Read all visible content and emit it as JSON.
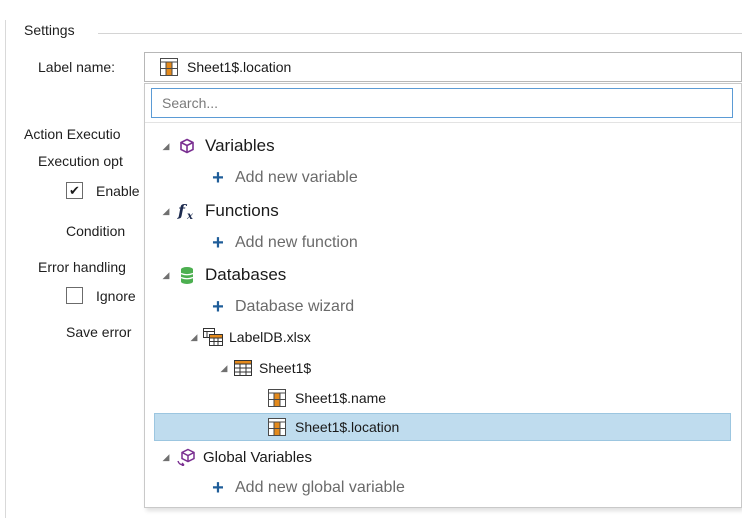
{
  "settings": {
    "title": "Settings",
    "label_name_label": "Label name:",
    "label_name_value": "Sheet1$.location",
    "action_execution": "Action Executio",
    "execution_options": "Execution opt",
    "enable_label": "Enable",
    "enable_checked": true,
    "condition_label": "Condition",
    "error_handling": "Error handling",
    "ignore_label": "Ignore",
    "ignore_checked": false,
    "save_error_label": "Save error"
  },
  "dropdown": {
    "search_placeholder": "Search...",
    "variables": {
      "label": "Variables",
      "add": "Add new variable"
    },
    "functions": {
      "label": "Functions",
      "add": "Add new function"
    },
    "databases": {
      "label": "Databases",
      "add": "Database wizard",
      "file": "LabelDB.xlsx",
      "sheet": "Sheet1$",
      "fields": [
        "Sheet1$.name",
        "Sheet1$.location"
      ]
    },
    "global_variables": {
      "label": "Global Variables",
      "add": "Add new global variable"
    },
    "selected": "Sheet1$.location"
  },
  "colors": {
    "selected_bg": "#bfdcee",
    "plus_blue": "#1f5d99",
    "variables_purple": "#7a2f91",
    "functions_navy": "#1d2b4f",
    "databases_green": "#4caf50",
    "field_orange": "#e48a1c",
    "search_border": "#5b9bd5"
  }
}
